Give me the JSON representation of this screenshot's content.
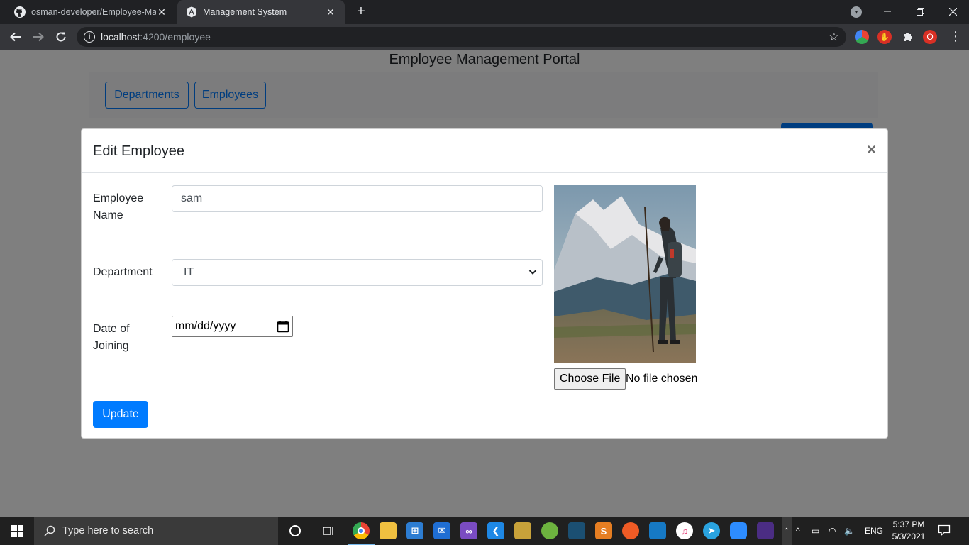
{
  "browser": {
    "tabs": [
      {
        "title": "osman-developer/Employee-Management",
        "icon": "github-icon",
        "close": "✕"
      },
      {
        "title": "Management System",
        "icon": "angular-icon",
        "close": "✕"
      }
    ],
    "new_tab": "+",
    "url_host": "localhost",
    "url_rest": ":4200/employee",
    "profile_badge": "O"
  },
  "page": {
    "title": "Employee Management Portal",
    "nav": [
      {
        "label": "Departments"
      },
      {
        "label": "Employees"
      }
    ]
  },
  "modal": {
    "title": "Edit Employee",
    "close": "×",
    "fields": {
      "name_label": "Employee Name",
      "name_value": "sam",
      "department_label": "Department",
      "department_value": "IT",
      "doj_label": "Date of Joining",
      "doj_placeholder": "mm/dd/yyyy"
    },
    "photo": {
      "file_button": "Choose File",
      "file_status": "No file chosen"
    },
    "submit": "Update"
  },
  "taskbar": {
    "search_placeholder": "Type here to search",
    "apps": [
      "chrome-icon",
      "file-explorer-icon",
      "store-icon",
      "mail-icon",
      "visual-studio-icon",
      "vscode-icon",
      "app-icon",
      "spring-icon",
      "mysql-workbench-icon",
      "sublime-text-icon",
      "postman-icon",
      "wireshark-icon",
      "itunes-icon",
      "telegram-icon",
      "zoom-icon",
      "terminal-icon"
    ],
    "language": "ENG",
    "time": "5:37 PM",
    "date": "5/3/2021"
  },
  "colors": {
    "primary": "#007bff",
    "backdrop": "rgba(0,0,0,0.5)",
    "chrome_dark": "#202124",
    "chrome_toolbar": "#35363a"
  }
}
